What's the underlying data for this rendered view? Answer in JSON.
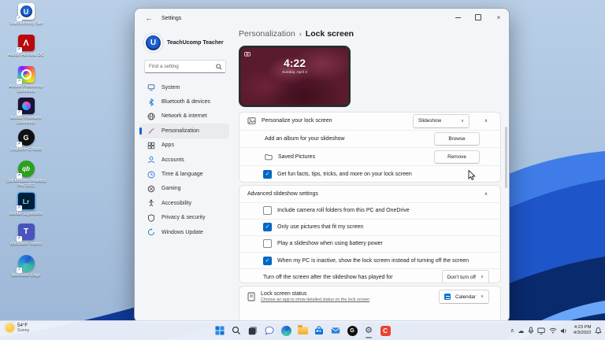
{
  "colors": {
    "accent": "#0067c4",
    "sky_top": "#b9cfe7",
    "bloom_dark": "#0a2a6e",
    "bloom_mid": "#1e55c8",
    "bloom_light": "#3f7ce8",
    "taskbar_bg": "#eef3fa",
    "window_bg": "#f3f5f9",
    "card_bg": "#fdfdfd"
  },
  "desktop": {
    "icons": [
      {
        "label": "TeachUcomp Site",
        "glyph": "U"
      },
      {
        "label": "Adobe Acrobat DC",
        "glyph": "Λ"
      },
      {
        "label": "Adobe Photoshop Elements",
        "glyph": ""
      },
      {
        "label": "Adobe Premiere Elements",
        "glyph": ""
      },
      {
        "label": "Logitech G HUB",
        "glyph": "G"
      },
      {
        "label": "QuickBooks Desktop Pro 2022",
        "glyph": "qb"
      },
      {
        "label": "Adobe Lightroom",
        "glyph": "Lr"
      },
      {
        "label": "Microsoft Teams",
        "glyph": "T"
      },
      {
        "label": "Microsoft Edge",
        "glyph": ""
      }
    ]
  },
  "window": {
    "titlebar": {
      "title": "Settings",
      "back_icon": "←",
      "close_icon": "×"
    },
    "sidebar": {
      "user": {
        "name": "TeachUcomp Teacher",
        "avatar_letter": "U"
      },
      "search": {
        "placeholder": "Find a setting"
      },
      "nav": [
        {
          "label": "System",
          "icon": "monitor-icon",
          "selected": false
        },
        {
          "label": "Bluetooth & devices",
          "icon": "bluetooth-icon",
          "selected": false
        },
        {
          "label": "Network & internet",
          "icon": "globe-icon",
          "selected": false
        },
        {
          "label": "Personalization",
          "icon": "brush-icon",
          "selected": true
        },
        {
          "label": "Apps",
          "icon": "apps-grid-icon",
          "selected": false
        },
        {
          "label": "Accounts",
          "icon": "person-icon",
          "selected": false
        },
        {
          "label": "Time & language",
          "icon": "clock-icon",
          "selected": false
        },
        {
          "label": "Gaming",
          "icon": "xbox-icon",
          "selected": false
        },
        {
          "label": "Accessibility",
          "icon": "accessibility-icon",
          "selected": false
        },
        {
          "label": "Privacy & security",
          "icon": "shield-icon",
          "selected": false
        },
        {
          "label": "Windows Update",
          "icon": "update-icon",
          "selected": false
        }
      ]
    },
    "main": {
      "breadcrumb": {
        "parent": "Personalization",
        "separator": "›",
        "current": "Lock screen"
      },
      "preview": {
        "time": "4:22",
        "date": "Sunday, April 3"
      },
      "personalize_card": {
        "title": "Personalize your lock screen",
        "dropdown_value": "Slideshow",
        "dropdown_chevron": "∨",
        "collapse_icon": "∧",
        "album_row": {
          "label": "Add an album for your slideshow",
          "button": "Browse"
        },
        "folder_row": {
          "label": "Saved Pictures",
          "button": "Remove"
        },
        "fun_facts_row": {
          "label": "Get fun facts, tips, tricks, and more on your lock screen",
          "checked": true
        }
      },
      "advanced_card": {
        "title": "Advanced slideshow settings",
        "collapse_icon": "∧",
        "checkboxes": [
          {
            "label": "Include camera roll folders from this PC and OneDrive",
            "checked": false
          },
          {
            "label": "Only use pictures that fit my screen",
            "checked": true
          },
          {
            "label": "Play a slideshow when using battery power",
            "checked": false
          },
          {
            "label": "When my PC is inactive, show the lock screen instead of turning off the screen",
            "checked": true
          }
        ],
        "footer": {
          "label": "Turn off the screen after the slideshow has played for",
          "dropdown_value": "Don't turn off",
          "dropdown_chevron": "∨"
        }
      },
      "status_card": {
        "title": "Lock screen status",
        "subtitle": "Choose an app to show detailed status on the lock screen",
        "dropdown_value": "Calendar",
        "dropdown_chevron": "∨"
      }
    }
  },
  "taskbar": {
    "weather": {
      "temp": "54°F",
      "condition": "Sunny"
    },
    "icons": [
      "start-icon",
      "search-icon",
      "task-view-icon",
      "chat-icon",
      "edge-icon",
      "file-explorer-icon",
      "store-icon",
      "mail-icon",
      "ghub-icon",
      "settings-gear-icon",
      "camtasia-icon"
    ],
    "glyphs": {
      "ghub": "G",
      "camtasia": "C",
      "gear": "⚙"
    },
    "tray": {
      "chevron": "∧",
      "cloud": "☁",
      "clock_time": "4:23 PM",
      "clock_date": "4/3/2022"
    }
  }
}
